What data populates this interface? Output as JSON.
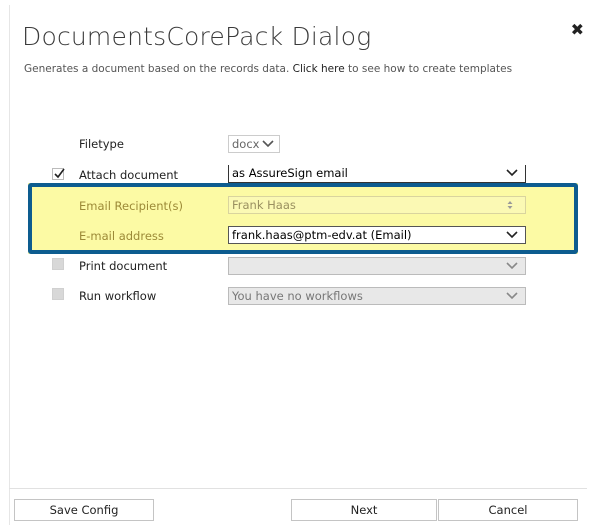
{
  "dialog": {
    "title": "DocumentsCorePack Dialog",
    "close_glyph": "✖",
    "subtitle_before": "Generates a document based on the records data. ",
    "subtitle_link": "Click here",
    "subtitle_after": " to see how to create templates"
  },
  "fields": {
    "filetype": {
      "label": "Filetype",
      "value": "docx"
    },
    "attach": {
      "label": "Attach document",
      "checked": true,
      "value": "as AssureSign email"
    },
    "recipients": {
      "label": "Email Recipient(s)",
      "value": "Frank Haas"
    },
    "email": {
      "label": "E-mail address",
      "value": "frank.haas@ptm-edv.at (Email)"
    },
    "print": {
      "label": "Print document",
      "checked": false,
      "value": ""
    },
    "workflow": {
      "label": "Run workflow",
      "checked": false,
      "value": "You have no workflows"
    }
  },
  "buttons": {
    "save": "Save Config",
    "next": "Next",
    "cancel": "Cancel"
  },
  "colors": {
    "highlight_border": "#0d5c8f",
    "highlight_fill": "#fcfaa4"
  },
  "icons": [
    "close-icon",
    "chevron-down-icon",
    "checkmark-icon",
    "updown-arrows-icon"
  ]
}
